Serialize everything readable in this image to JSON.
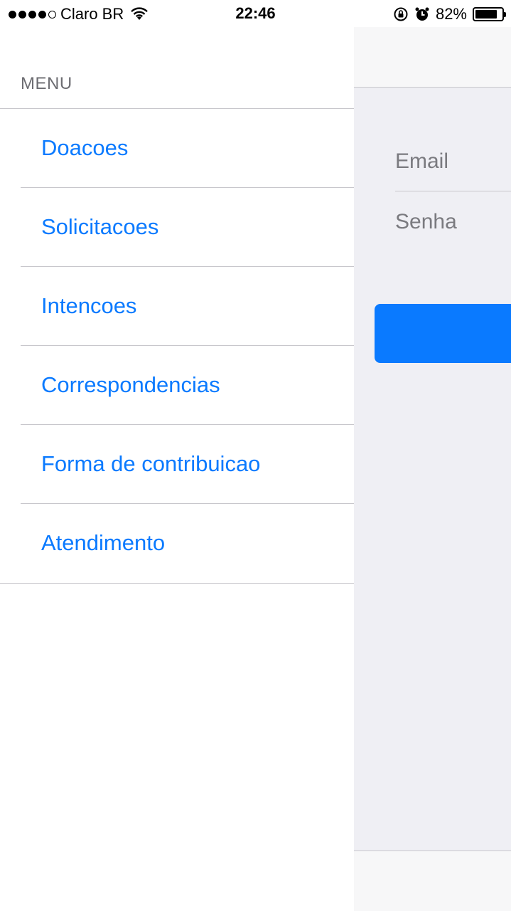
{
  "status_bar": {
    "carrier": "Claro BR",
    "time": "22:46",
    "battery_percent": "82%",
    "battery_level": 0.82,
    "signal_bars_filled": 4,
    "signal_bars_total": 5
  },
  "drawer": {
    "section_title": "MENU",
    "items": [
      {
        "label": "Doacoes"
      },
      {
        "label": "Solicitacoes"
      },
      {
        "label": "Intencoes"
      },
      {
        "label": "Correspondencias"
      },
      {
        "label": "Forma de contribuicao"
      },
      {
        "label": "Atendimento"
      }
    ]
  },
  "background_screen": {
    "email_placeholder": "Email",
    "password_placeholder": "Senha"
  },
  "colors": {
    "accent": "#0a7aff",
    "separator": "#c8c7cc",
    "group_background": "#efeff4"
  }
}
